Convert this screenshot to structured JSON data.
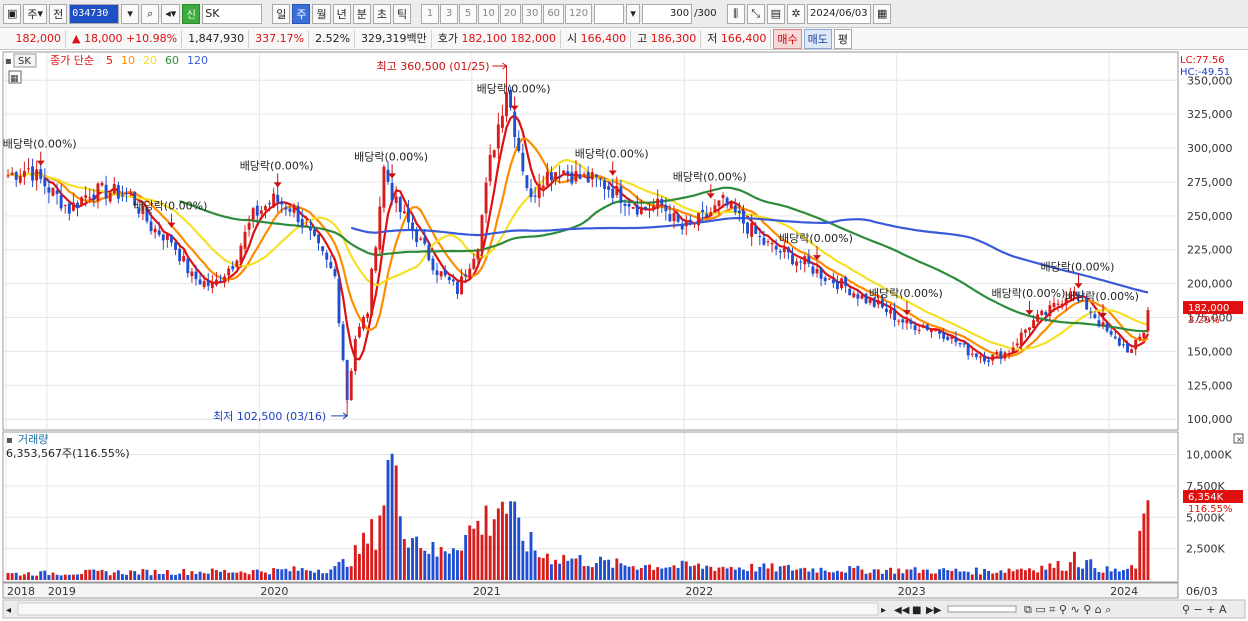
{
  "toolbar": {
    "period_label": "주",
    "prev_label": "전",
    "code": "034730",
    "market_tag": "신",
    "name": "SK",
    "tabs": [
      "일",
      "주",
      "월",
      "년",
      "분",
      "초",
      "틱"
    ],
    "active_tab": "주",
    "interval_buttons": [
      "1",
      "3",
      "5",
      "10",
      "20",
      "30",
      "60",
      "120"
    ],
    "count": "300",
    "count_total": "/300",
    "date": "2024/06/03"
  },
  "quote": {
    "price": "182,000",
    "change": "18,000",
    "change_pct": "+10.98%",
    "volume": "1,847,930",
    "volume_ratio": "337.17%",
    "turnover": "2.52%",
    "amount": "329,319백만",
    "bid_label": "호가",
    "bid": "182,100",
    "ask": "182,000",
    "open_label": "시",
    "open": "166,400",
    "high_label": "고",
    "high": "186,300",
    "low_label": "저",
    "low": "166,400",
    "buy_label": "매수",
    "sell_label": "매도",
    "flat_label": "평"
  },
  "price_panel": {
    "symbol": "SK",
    "legend_title": "종가 단순",
    "ma_periods": [
      "5",
      "10",
      "20",
      "60",
      "120"
    ],
    "ma_colors": [
      "#e01010",
      "#ff8c00",
      "#f5e028",
      "#2e8b3a",
      "#3a5bd8"
    ],
    "lc": "LC:77.56",
    "hc": "HC:-49.51",
    "last_price_tag": "182,000",
    "last_pct_tag": "3.29%",
    "high_annotation": "최고 360,500 (01/25)",
    "low_annotation": "최저 102,500 (03/16)",
    "dividend_label": "배당락(0.00%)",
    "y_ticks": [
      "350,000",
      "325,000",
      "300,000",
      "275,000",
      "250,000",
      "225,000",
      "200,000",
      "175,000",
      "150,000",
      "125,000",
      "100,000"
    ]
  },
  "volume_panel": {
    "title": "거래량",
    "last_value": "6,353,567주(116.55%)",
    "y_ticks": [
      "10,000K",
      "7,500K",
      "5,000K",
      "2,500K"
    ],
    "last_tag": "6,354K",
    "last_pct_tag": "116.55%"
  },
  "x_axis": {
    "labels": [
      "2018",
      "2019",
      "2020",
      "2021",
      "2022",
      "2023",
      "2024"
    ],
    "right_label": "06/03"
  },
  "colors": {
    "up": "#d81c1c",
    "down": "#1f4fd0",
    "grid": "#e6e6e6"
  },
  "chart_data": {
    "type": "candlestick",
    "title": "",
    "ylim": [
      95000,
      362000
    ],
    "weeks": 280,
    "close_points": [
      [
        0,
        280000
      ],
      [
        5,
        285000
      ],
      [
        10,
        270000
      ],
      [
        15,
        255000
      ],
      [
        20,
        268000
      ],
      [
        25,
        268000
      ],
      [
        30,
        265000
      ],
      [
        35,
        242000
      ],
      [
        40,
        232000
      ],
      [
        45,
        205000
      ],
      [
        50,
        198000
      ],
      [
        55,
        215000
      ],
      [
        60,
        250000
      ],
      [
        65,
        262000
      ],
      [
        70,
        255000
      ],
      [
        75,
        230000
      ],
      [
        80,
        205000
      ],
      [
        83,
        115000
      ],
      [
        85,
        160000
      ],
      [
        88,
        180000
      ],
      [
        92,
        285000
      ],
      [
        95,
        258000
      ],
      [
        100,
        235000
      ],
      [
        105,
        210000
      ],
      [
        110,
        195000
      ],
      [
        115,
        230000
      ],
      [
        118,
        290000
      ],
      [
        122,
        345000
      ],
      [
        125,
        300000
      ],
      [
        128,
        260000
      ],
      [
        130,
        278000
      ],
      [
        135,
        285000
      ],
      [
        140,
        278000
      ],
      [
        145,
        275000
      ],
      [
        150,
        265000
      ],
      [
        155,
        255000
      ],
      [
        160,
        258000
      ],
      [
        165,
        240000
      ],
      [
        170,
        248000
      ],
      [
        175,
        260000
      ],
      [
        180,
        245000
      ],
      [
        185,
        230000
      ],
      [
        190,
        222000
      ],
      [
        195,
        215000
      ],
      [
        200,
        205000
      ],
      [
        205,
        198000
      ],
      [
        210,
        188000
      ],
      [
        215,
        180000
      ],
      [
        220,
        170000
      ],
      [
        225,
        168000
      ],
      [
        230,
        162000
      ],
      [
        235,
        150000
      ],
      [
        240,
        145000
      ],
      [
        245,
        150000
      ],
      [
        250,
        170000
      ],
      [
        255,
        180000
      ],
      [
        260,
        195000
      ],
      [
        265,
        180000
      ],
      [
        270,
        160000
      ],
      [
        275,
        150000
      ],
      [
        278,
        165000
      ],
      [
        279,
        182000
      ]
    ],
    "volume_points": [
      [
        0,
        500
      ],
      [
        20,
        600
      ],
      [
        60,
        700
      ],
      [
        80,
        900
      ],
      [
        85,
        2000
      ],
      [
        90,
        4000
      ],
      [
        94,
        10000
      ],
      [
        95,
        7000
      ],
      [
        96,
        6000
      ],
      [
        98,
        4000
      ],
      [
        105,
        2000
      ],
      [
        118,
        5000
      ],
      [
        121,
        6500
      ],
      [
        123,
        5000
      ],
      [
        126,
        3500
      ],
      [
        130,
        2000
      ],
      [
        150,
        1200
      ],
      [
        180,
        1000
      ],
      [
        210,
        800
      ],
      [
        240,
        700
      ],
      [
        260,
        1200
      ],
      [
        261,
        2800
      ],
      [
        262,
        1500
      ],
      [
        270,
        700
      ],
      [
        276,
        900
      ],
      [
        278,
        5300
      ],
      [
        279,
        6354
      ]
    ],
    "dividend_weeks": [
      8,
      40,
      66,
      94,
      124,
      148,
      172,
      198,
      220,
      250,
      262,
      268
    ],
    "ma_periods": [
      5,
      10,
      20,
      60,
      120
    ]
  }
}
